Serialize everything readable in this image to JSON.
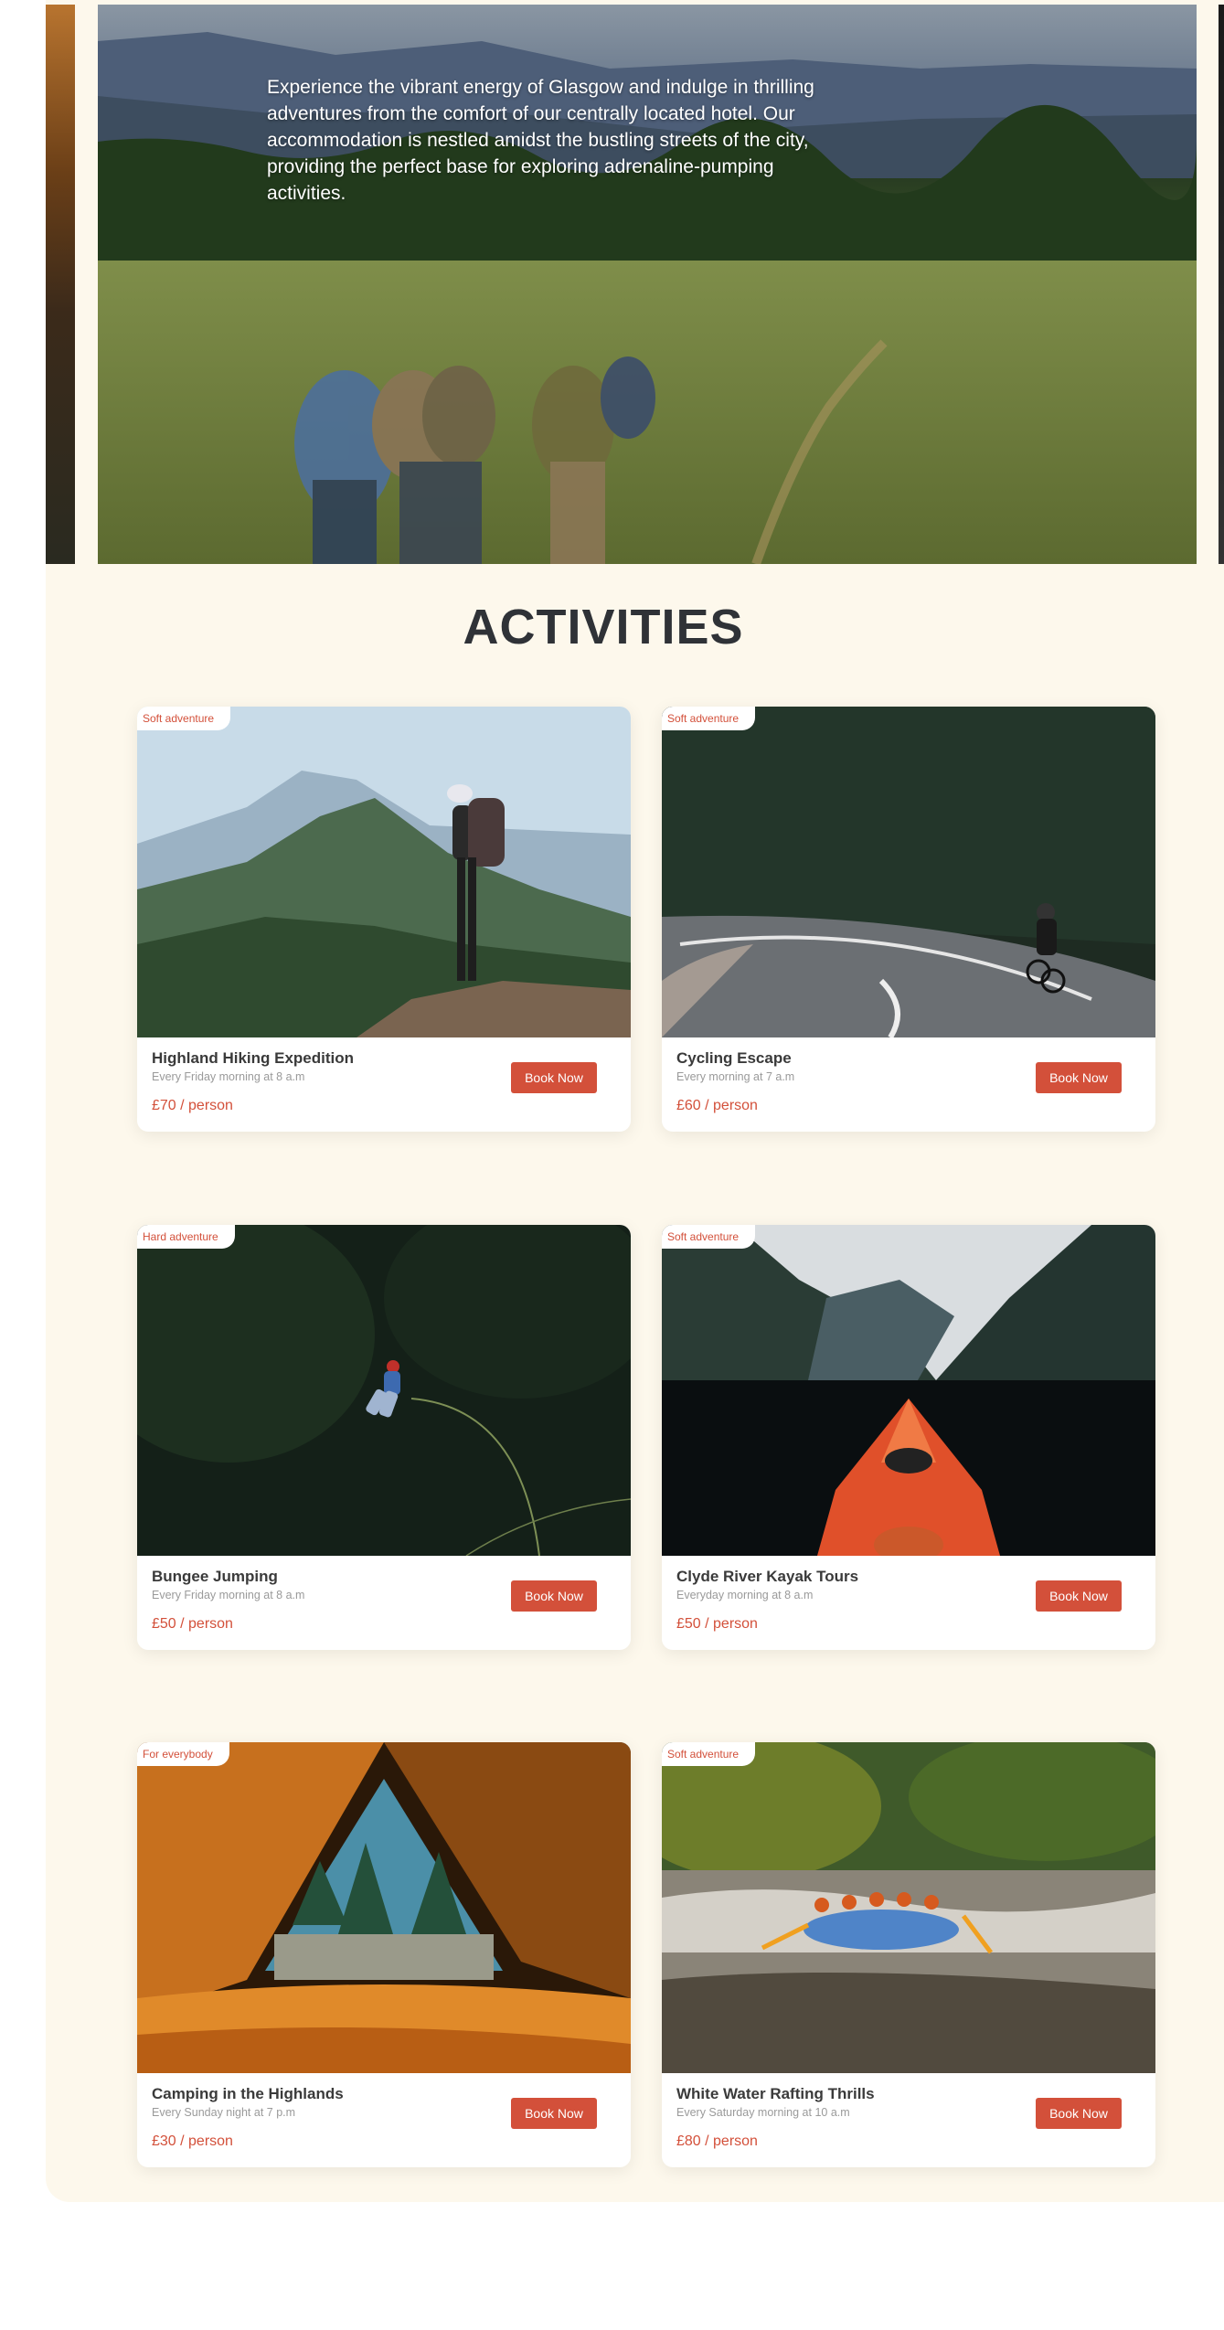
{
  "hero": {
    "description": "Experience the vibrant energy of Glasgow and indulge in thrilling adventures from the comfort of our centrally located hotel. Our accommodation is nestled amidst the bustling streets of the city, providing the perfect base for exploring adrenaline-pumping activities."
  },
  "section": {
    "title": "ACTIVITIES"
  },
  "colors": {
    "accent": "#d3503a",
    "panel_bg": "#fdf8ec",
    "title": "#2f3237"
  },
  "activities": [
    {
      "tag": "Soft adventure",
      "title": "Highland Hiking Expedition",
      "schedule": "Every Friday morning at 8 a.m",
      "price": "£70 / person",
      "button": "Book Now"
    },
    {
      "tag": "Soft adventure",
      "title": "Cycling Escape",
      "schedule": "Every morning at 7 a.m",
      "price": "£60 / person",
      "button": "Book Now"
    },
    {
      "tag": "Hard adventure",
      "title": "Bungee Jumping",
      "schedule": "Every Friday morning at 8 a.m",
      "price": "£50 / person",
      "button": "Book Now"
    },
    {
      "tag": "Soft adventure",
      "title": "Clyde River Kayak Tours",
      "schedule": "Everyday morning at 8 a.m",
      "price": "£50 / person",
      "button": "Book Now"
    },
    {
      "tag": "For everybody",
      "title": "Camping in the Highlands",
      "schedule": "Every Sunday night at 7 p.m",
      "price": "£30 / person",
      "button": "Book Now"
    },
    {
      "tag": "Soft adventure",
      "title": "White Water Rafting Thrills",
      "schedule": "Every Saturday morning at 10 a.m",
      "price": "£80 / person",
      "button": "Book Now"
    }
  ]
}
